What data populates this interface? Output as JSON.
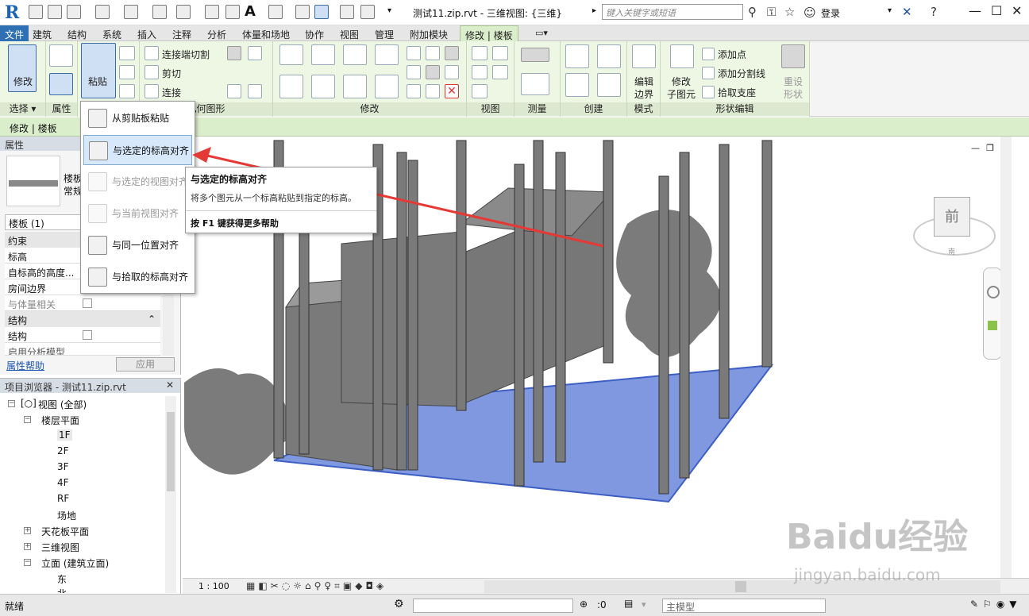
{
  "titlebar": {
    "title": "测试11.zip.rvt - 三维视图: {三维}",
    "search_placeholder": "键入关键字或短语",
    "login": "登录"
  },
  "tabs": [
    "文件",
    "建筑",
    "结构",
    "系统",
    "插入",
    "注释",
    "分析",
    "体量和场地",
    "协作",
    "视图",
    "管理",
    "附加模块",
    "修改 | 楼板"
  ],
  "ribbon": {
    "modify_label": "修改",
    "paste_label": "粘贴",
    "select_label": "选择 ▾",
    "properties_label": "属性",
    "geometry_label": "几何图形",
    "modify_panel_label": "修改",
    "view_label": "视图",
    "measure_label": "测量",
    "create_label": "创建",
    "mode_label": "模式",
    "shape_edit_label": "形状编辑",
    "cut_join": "连接端切割",
    "cut": "剪切",
    "join": "连接",
    "edit_boundary_1": "编辑",
    "edit_boundary_2": "边界",
    "modify_sub_1": "修改",
    "modify_sub_2": "子图元",
    "add_point": "添加点",
    "add_split_line": "添加分割线",
    "pick_support": "拾取支座",
    "reset_shape_1": "重设",
    "reset_shape_2": "形状"
  },
  "context_bar": "修改 | 楼板",
  "properties": {
    "header": "属性",
    "type_name_1": "楼板",
    "type_name_2": "常规",
    "selector": "楼板 (1)",
    "group_constraints": "约束",
    "rows": [
      "标高",
      "自标高的高度...",
      "房间边界",
      "与体量相关"
    ],
    "group_structure": "结构",
    "struct_rows": [
      "结构",
      "启用分析模型"
    ],
    "help_link": "属性帮助",
    "apply": "应用"
  },
  "browser": {
    "header": "项目浏览器 - 测试11.zip.rvt",
    "views": "视图 (全部)",
    "floor_plans": "楼层平面",
    "levels": [
      "1F",
      "2F",
      "3F",
      "4F",
      "RF",
      "场地"
    ],
    "ceiling": "天花板平面",
    "three_d": "三维视图",
    "elevations": "立面 (建筑立面)",
    "east": "东",
    "north": "北"
  },
  "dropdown": {
    "items": [
      "从剪贴板粘贴",
      "与选定的标高对齐",
      "与选定的视图对齐",
      "与当前视图对齐",
      "与同一位置对齐",
      "与拾取的标高对齐"
    ]
  },
  "tooltip": {
    "title": "与选定的标高对齐",
    "desc": "将多个图元从一个标高粘贴到指定的标高。",
    "help": "按 F1 键获得更多帮助"
  },
  "viewcube": {
    "face": "前",
    "side": "南"
  },
  "view_controls": {
    "scale": "1 : 100"
  },
  "status": {
    "text": "就绪",
    "count": ":0",
    "model": "主模型"
  },
  "watermark": {
    "brand": "Baidu经验",
    "url": "jingyan.baidu.com"
  },
  "colors": {
    "floor": "#7f98e0",
    "wall": "#7a7a7a",
    "accent": "#2f6fb3",
    "arrow": "#e53935",
    "ribbon_green": "#eef6e4"
  }
}
